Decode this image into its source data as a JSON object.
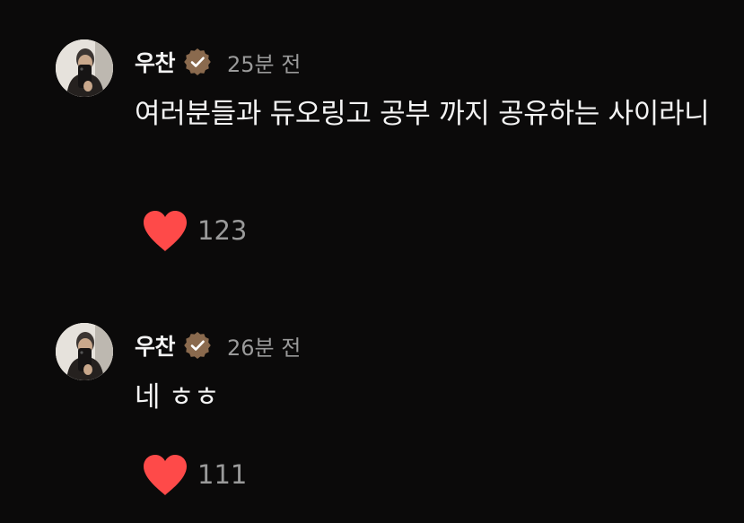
{
  "comments": [
    {
      "username": "우찬",
      "time": "25분 전",
      "text": "여러분들과 듀오링고 공부 까지 공유하는 사이라니",
      "likes": "123"
    },
    {
      "username": "우찬",
      "time": "26분 전",
      "text": "네 ㅎㅎ",
      "likes": "111"
    }
  ],
  "colors": {
    "background": "#0b0a0a",
    "verified_badge": "#8a6a4e",
    "heart": "#fe4a49",
    "text_primary": "#f4f4f4",
    "text_secondary": "#9a9a9a"
  },
  "icons": {
    "verified": "verified-badge-icon",
    "like": "heart-icon"
  }
}
